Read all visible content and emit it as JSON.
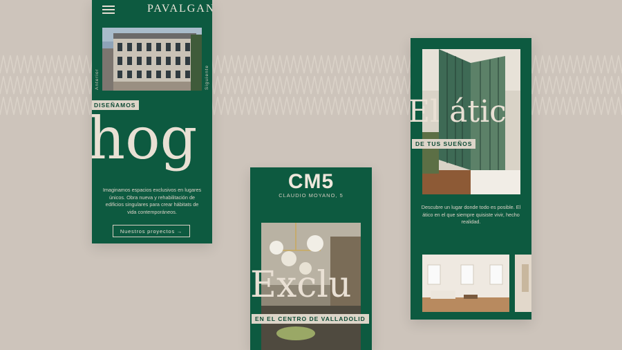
{
  "brand": "PAVALGAN",
  "card1": {
    "side_left": "Anterior",
    "side_right": "Siguiente",
    "tag": "DISEÑAMOS",
    "big_word": "hog",
    "description": "Imaginamos espacios exclusivos en lugares únicos. Obra nueva y rehabilitación de edificios singulares para crear hábitats de vida contemporáneos.",
    "button": "Nuestros proyectos →"
  },
  "card2": {
    "title": "CM5",
    "subtitle": "CLAUDIO MOYANO, 5",
    "big_word": "Exclu",
    "tag": "EN EL CENTRO DE VALLADOLID"
  },
  "card3": {
    "big_word": "El átic",
    "tag": "DE TUS SUEÑOS",
    "description": "Descubre un lugar donde todo es posible. El ático en el que siempre quisiste vivir, hecho realidad."
  },
  "colors": {
    "background": "#cdc4bb",
    "card_green": "#0d5a40",
    "cream": "#e8dfd4"
  }
}
